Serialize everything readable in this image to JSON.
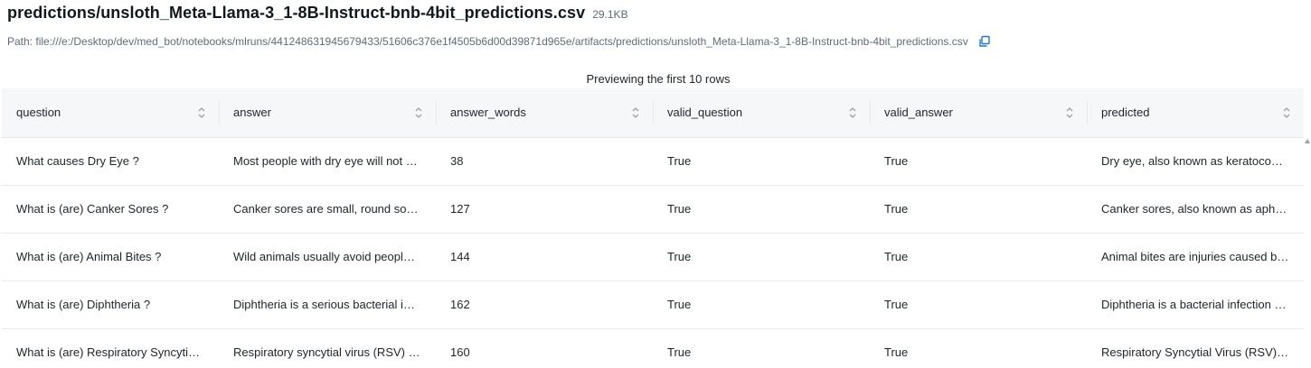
{
  "header": {
    "title": "predictions/unsloth_Meta-Llama-3_1-8B-Instruct-bnb-4bit_predictions.csv",
    "size": "29.1KB",
    "path": "Path: file:///e:/Desktop/dev/med_bot/notebooks/mlruns/441248631945679433/51606c376e1f4505b6d00d39871d965e/artifacts/predictions/unsloth_Meta-Llama-3_1-8B-Instruct-bnb-4bit_predictions.csv",
    "copy_icon": "copy-icon"
  },
  "preview": {
    "note": "Previewing the first 10 rows"
  },
  "table": {
    "columns": [
      "question",
      "answer",
      "answer_words",
      "valid_question",
      "valid_answer",
      "predicted"
    ],
    "rows": [
      [
        "What causes Dry Eye ?",
        "Most people with dry eye will not …",
        "38",
        "True",
        "True",
        "Dry eye, also known as keratoconj…"
      ],
      [
        "What is (are) Canker Sores ?",
        "Canker sores are small, round sore…",
        "127",
        "True",
        "True",
        "Canker sores, also known as aphth…"
      ],
      [
        "What is (are) Animal Bites ?",
        "Wild animals usually avoid people.…",
        "144",
        "True",
        "True",
        "Animal bites are injuries caused by…"
      ],
      [
        "What is (are) Diphtheria ?",
        "Diphtheria is a serious bacterial inf…",
        "162",
        "True",
        "True",
        "Diphtheria is a bacterial infection c…"
      ],
      [
        "What is (are) Respiratory Syncytial …",
        "Respiratory syncytial virus (RSV) ca…",
        "160",
        "True",
        "True",
        "Respiratory Syncytial Virus (RSV) i…"
      ]
    ]
  },
  "colors": {
    "accent": "#1a73e8",
    "header_bg": "#f6f7f9",
    "muted": "#5f6b7a"
  }
}
